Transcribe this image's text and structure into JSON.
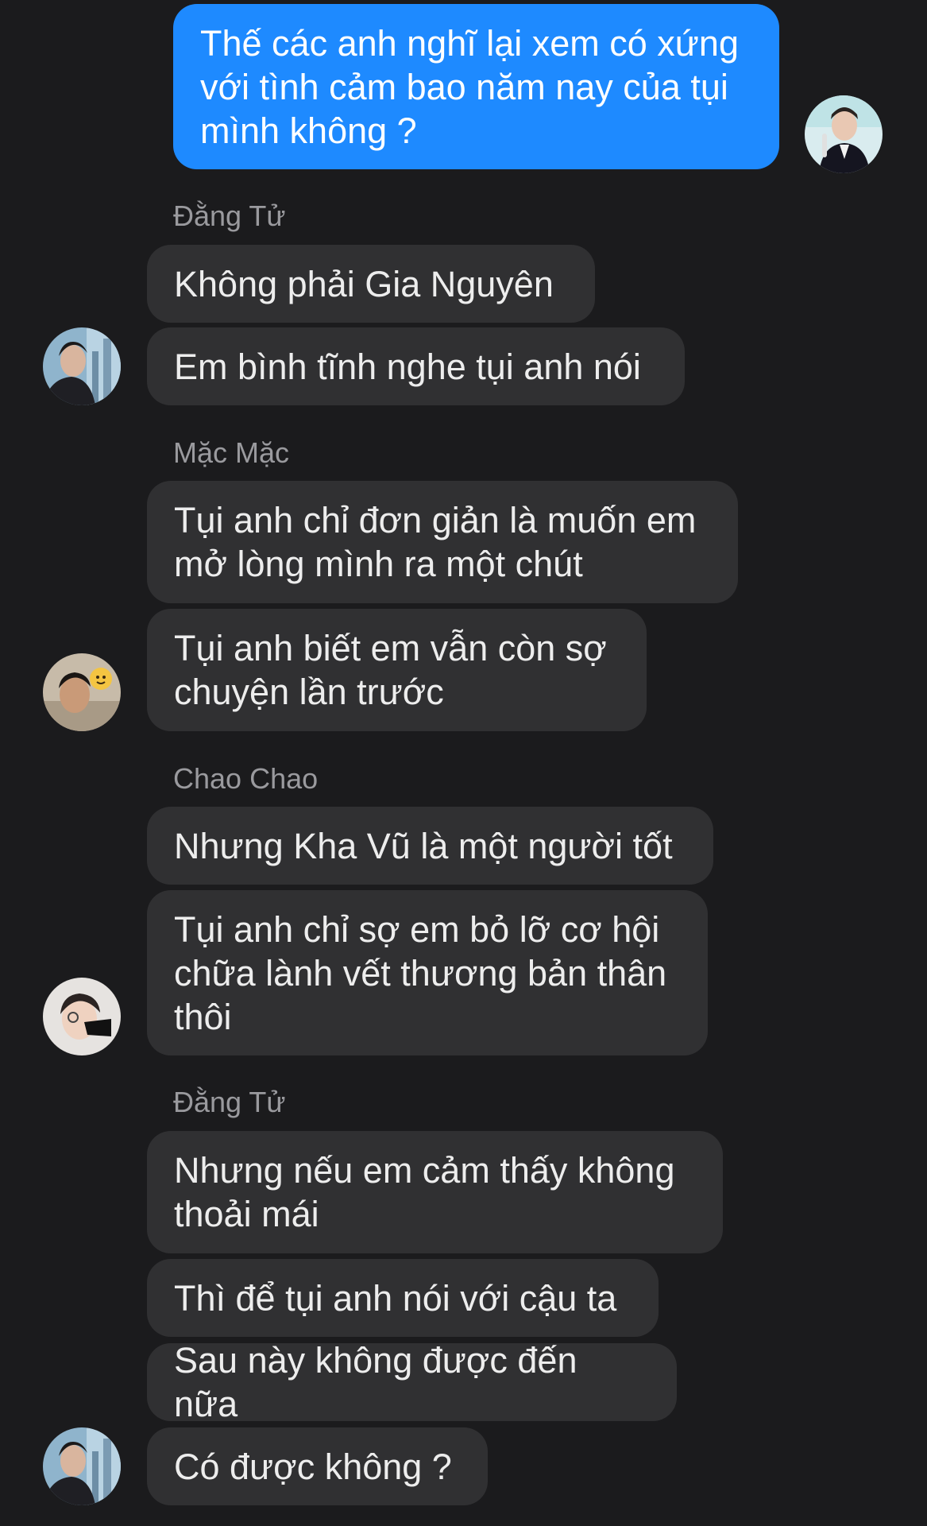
{
  "conversation": {
    "outgoing": {
      "text": "Thế các anh nghĩ lại xem có xứng\nvới tình cảm bao năm nay của tụi\nmình không ?"
    },
    "groups": [
      {
        "sender": "Đằng Tử",
        "messages": [
          "Không phải Gia Nguyên",
          "Em bình tĩnh nghe tụi anh nói"
        ]
      },
      {
        "sender": "Mặc Mặc",
        "messages": [
          "Tụi anh chỉ đơn giản là muốn em\nmở lòng mình ra một chút",
          "Tụi anh biết em vẫn còn sợ\nchuyện lần trước"
        ]
      },
      {
        "sender": "Chao Chao",
        "messages": [
          "Nhưng Kha Vũ là một người tốt",
          "Tụi anh chỉ sợ em bỏ lỡ cơ hội\nchữa lành vết thương bản thân\nthôi"
        ]
      },
      {
        "sender": "Đằng Tử",
        "messages": [
          "Nhưng nếu em cảm thấy không\nthoải mái",
          "Thì để tụi anh nói với cậu ta",
          "Sau này không được đến nữa",
          "Có được không ?"
        ]
      }
    ]
  },
  "avatars": {
    "self": "profile-photo-avatar",
    "dang_tu": "profile-photo-avatar",
    "mac_mac": "profile-photo-avatar",
    "chao_chao": "profile-photo-avatar"
  },
  "colors": {
    "background": "#1b1b1d",
    "incoming_bubble": "#303032",
    "outgoing_bubble": "#1e8aff",
    "sender_name": "#9a9a9e"
  }
}
